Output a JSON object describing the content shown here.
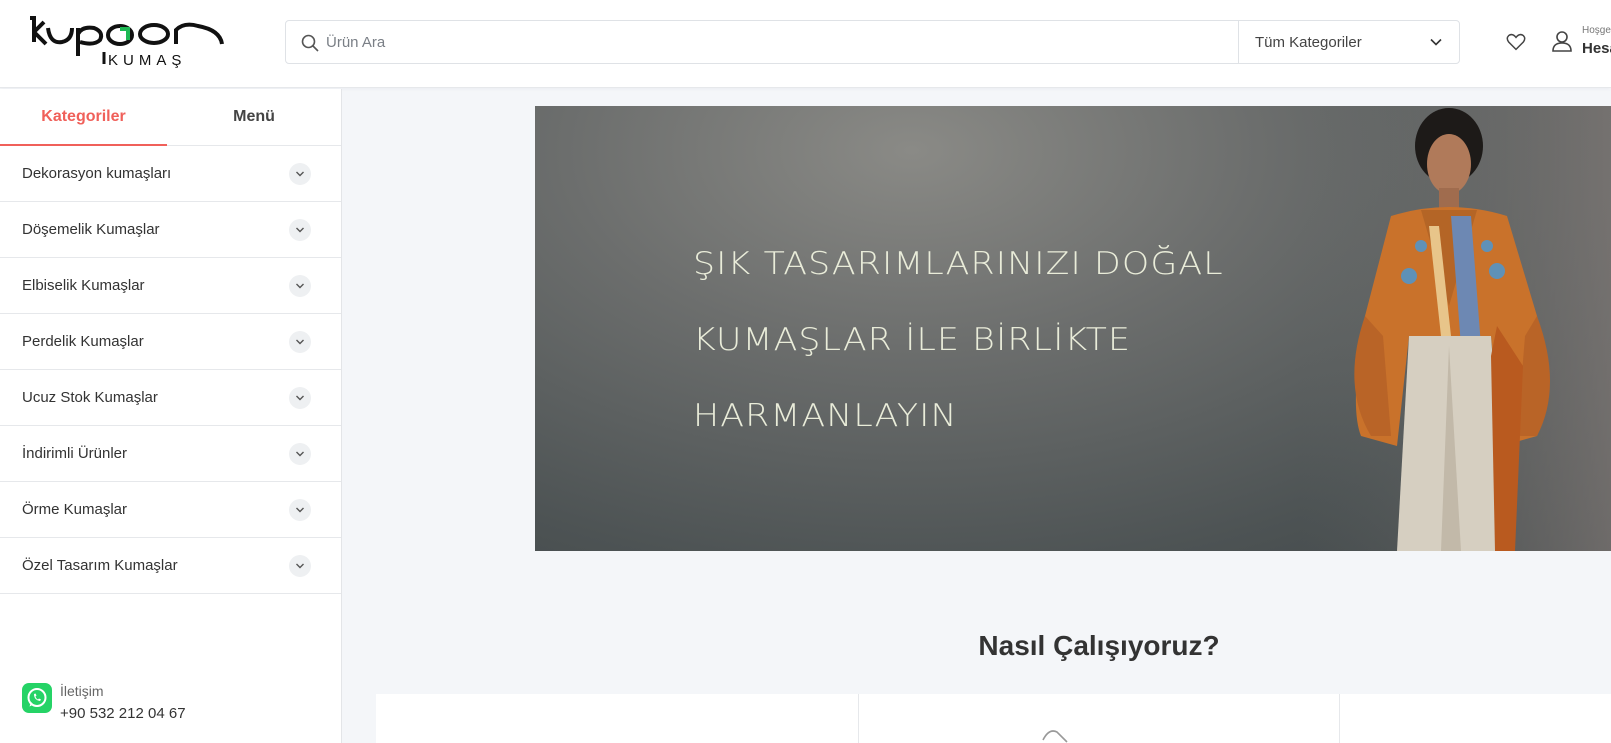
{
  "header": {
    "logo_text": "kupon KUMAŞ",
    "search_placeholder": "Ürün Ara",
    "category_select": "Tüm Kategoriler",
    "greeting_small": "Hoşgeldiniz",
    "greeting_big": "Hesabım"
  },
  "sidebar": {
    "tabs": [
      {
        "label": "Kategoriler",
        "active": true
      },
      {
        "label": "Menü",
        "active": false
      }
    ],
    "categories": [
      {
        "label": "Dekorasyon kumaşları"
      },
      {
        "label": "Döşemelik Kumaşlar"
      },
      {
        "label": "Elbiselik Kumaşlar"
      },
      {
        "label": "Perdelik Kumaşlar"
      },
      {
        "label": "Ucuz Stok Kumaşlar"
      },
      {
        "label": "İndirimli Ürünler"
      },
      {
        "label": "Örme Kumaşlar"
      },
      {
        "label": "Özel Tasarım Kumaşlar"
      }
    ],
    "contact": {
      "label": "İletişim",
      "phone": "+90 532 212 04 67"
    }
  },
  "hero": {
    "lines": [
      "ŞIK TASARIMLARINIZI DOĞAL",
      "KUMAŞLAR İLE BİRLİKTE",
      "HARMANLAYIN"
    ]
  },
  "how_it_works": {
    "title": "Nasıl Çalışıyoruz?"
  },
  "colors": {
    "accent": "#f0605a",
    "whatsapp": "#25d366",
    "logo_green": "#1db954"
  }
}
